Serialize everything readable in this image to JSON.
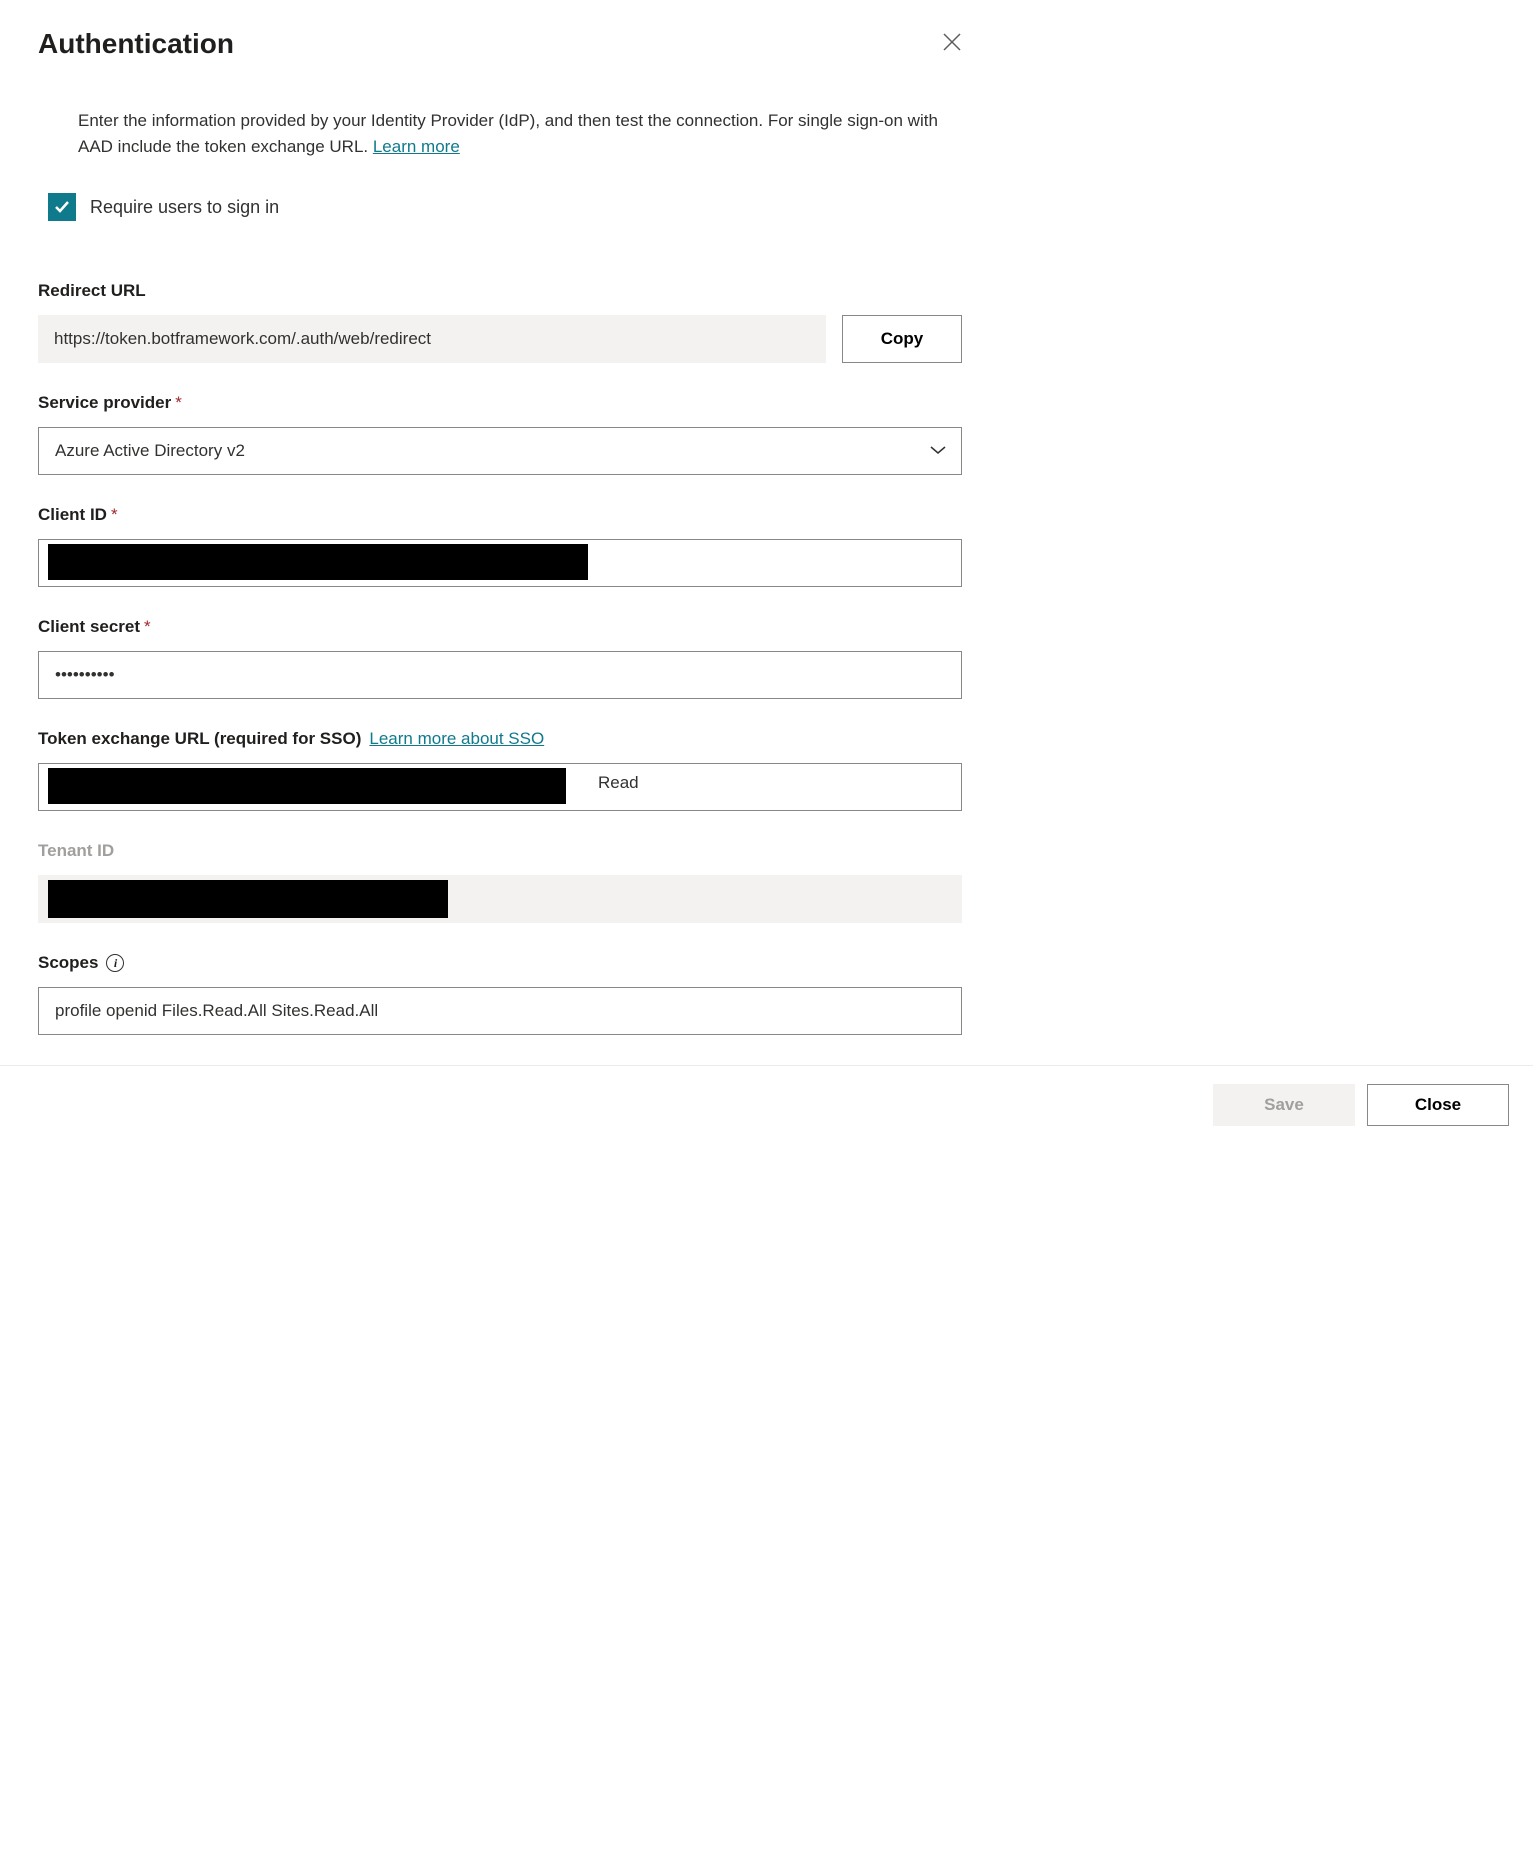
{
  "header": {
    "title": "Authentication"
  },
  "intro": {
    "text": "Enter the information provided by your Identity Provider (IdP), and then test the connection. For single sign-on with AAD include the token exchange URL. ",
    "link": "Learn more"
  },
  "checkbox": {
    "label": "Require users to sign in",
    "checked": true
  },
  "fields": {
    "redirect_url": {
      "label": "Redirect URL",
      "value": "https://token.botframework.com/.auth/web/redirect",
      "copy_button": "Copy"
    },
    "service_provider": {
      "label": "Service provider",
      "required": true,
      "value": "Azure Active Directory v2"
    },
    "client_id": {
      "label": "Client ID",
      "required": true,
      "value": "                                                                     "
    },
    "client_secret": {
      "label": "Client secret",
      "required": true,
      "value": "••••••••••"
    },
    "token_exchange": {
      "label": "Token exchange URL (required for SSO)",
      "link": "Learn more about SSO",
      "suffix": "Read",
      "value": "                                                                     "
    },
    "tenant_id": {
      "label": "Tenant ID",
      "value": "                                               "
    },
    "scopes": {
      "label": "Scopes",
      "value": "profile openid Files.Read.All Sites.Read.All"
    }
  },
  "footer": {
    "save": "Save",
    "close": "Close"
  }
}
